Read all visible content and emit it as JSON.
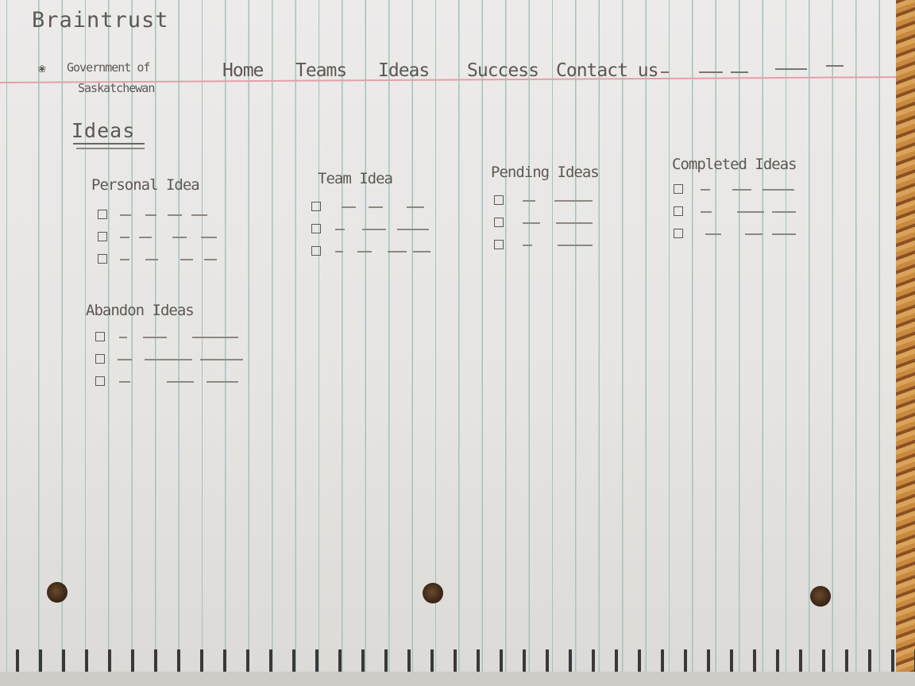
{
  "app": {
    "title": "Braintrust"
  },
  "brand": {
    "logo_icon": "wheat-sheaf-icon",
    "line1": "Government of",
    "line2": "Saskatchewan"
  },
  "nav": {
    "items": [
      "Home",
      "Teams",
      "Ideas",
      "Success",
      "Contact us"
    ]
  },
  "page": {
    "title": "Ideas"
  },
  "sections": {
    "personal": {
      "heading": "Personal Idea"
    },
    "team": {
      "heading": "Team Idea"
    },
    "pending": {
      "heading": "Pending Ideas"
    },
    "completed": {
      "heading": "Completed Ideas"
    },
    "abandoned": {
      "heading": "Abandon Ideas"
    }
  },
  "colors": {
    "pencil": "#5d5852",
    "paper": "#ecebea",
    "rule_line": "#9fc4c0",
    "margin_line": "#e4a0a8"
  }
}
